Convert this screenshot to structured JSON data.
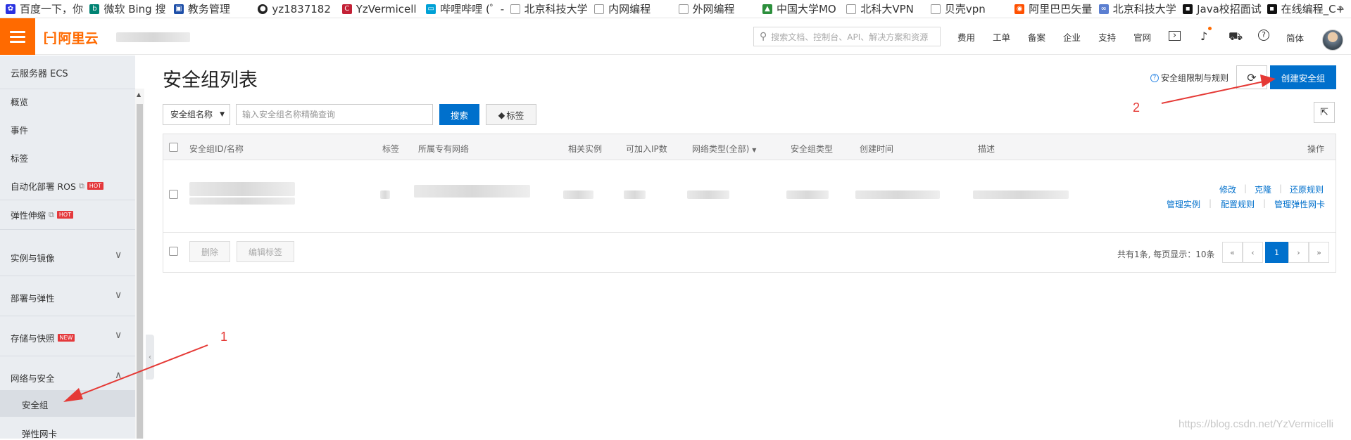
{
  "bookmarks": [
    {
      "label": "百度一下，你",
      "icon": "paw-icon",
      "color": "#2932e1"
    },
    {
      "label": "微软 Bing 搜",
      "icon": "bing-icon",
      "color": "#008373"
    },
    {
      "label": "教务管理",
      "icon": "bus-icon",
      "color": "#1e4fa8"
    },
    {
      "label": "yz1837182",
      "icon": "github-icon",
      "color": "#222222"
    },
    {
      "label": "YzVermicell",
      "icon": "csdn-icon",
      "color": "#c32136"
    },
    {
      "label": "哔哩哔哩 (゜-",
      "icon": "bilibili-icon",
      "color": "#00a1d6"
    },
    {
      "label": "北京科技大学",
      "icon": "page-icon",
      "color": "#999999"
    },
    {
      "label": "内网编程",
      "icon": "page-icon",
      "color": "#999999"
    },
    {
      "label": "外网编程",
      "icon": "page-icon",
      "color": "#999999"
    },
    {
      "label": "中国大学MO",
      "icon": "mooc-icon",
      "color": "#2c8f3c"
    },
    {
      "label": "北科大VPN",
      "icon": "page-icon",
      "color": "#999999"
    },
    {
      "label": "贝壳vpn",
      "icon": "page-icon",
      "color": "#999999"
    },
    {
      "label": "阿里巴巴矢量",
      "icon": "iconfont-icon",
      "color": "#ff5000"
    },
    {
      "label": "北京科技大学",
      "icon": "cnki-icon",
      "color": "#5b7fd1"
    },
    {
      "label": "Java校招面试",
      "icon": "nowcoder-icon",
      "color": "#111111"
    },
    {
      "label": "在线编程_C+",
      "icon": "nowcoder-icon",
      "color": "#111111"
    }
  ],
  "topnav": {
    "logo_text": "阿里云",
    "search_placeholder": "搜索文档、控制台、API、解决方案和资源",
    "links": [
      "费用",
      "工单",
      "备案",
      "企业",
      "支持",
      "官网"
    ],
    "lang": "简体"
  },
  "sidebar": {
    "title": "云服务器 ECS",
    "items": [
      {
        "label": "概览"
      },
      {
        "label": "事件"
      },
      {
        "label": "标签"
      },
      {
        "label": "自动化部署 ROS",
        "badge": "HOT"
      },
      {
        "label": "弹性伸缩",
        "badge": "HOT"
      }
    ],
    "groups": [
      {
        "label": "实例与镜像"
      },
      {
        "label": "部署与弹性"
      },
      {
        "label": "存储与快照",
        "badge": "NEW"
      },
      {
        "label": "网络与安全"
      }
    ],
    "subitems": [
      {
        "label": "安全组",
        "active": true
      },
      {
        "label": "弹性网卡"
      }
    ]
  },
  "main": {
    "title": "安全组列表",
    "limit_link": "安全组限制与规则",
    "create_button": "创建安全组",
    "filter_select": "安全组名称",
    "search_placeholder": "输入安全组名称精确查询",
    "search_button": "搜索",
    "tag_button": "标签",
    "columns": [
      "安全组ID/名称",
      "标签",
      "所属专有网络",
      "相关实例",
      "可加入IP数",
      "网络类型(全部)",
      "安全组类型",
      "创建时间",
      "描述",
      "操作"
    ],
    "row_ops": [
      "修改",
      "克隆",
      "还原规则",
      "管理实例",
      "配置规则",
      "管理弹性网卡"
    ],
    "delete_button": "删除",
    "edit_tags_button": "编辑标签",
    "total_text": "共有1条, 每页显示：10条",
    "pagination": [
      "«",
      "‹",
      "1",
      "›",
      "»"
    ]
  },
  "annotations": {
    "label_1": "1",
    "label_2": "2"
  },
  "watermark": "https://blog.csdn.net/YzVermicelli",
  "colors": {
    "brand_orange": "#ff6a00",
    "primary_blue": "#0070cc",
    "annotation_red": "#e53935"
  }
}
